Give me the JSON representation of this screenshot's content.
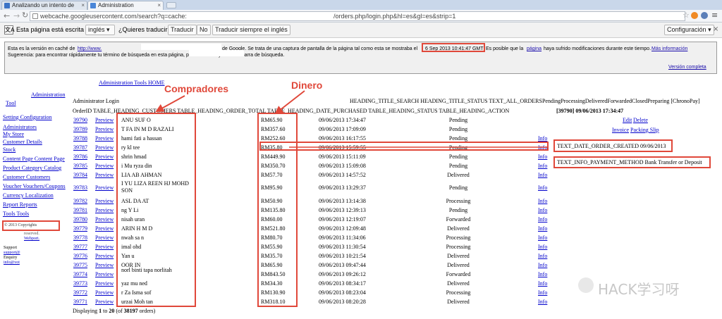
{
  "tabs": [
    {
      "label": "Analizando un intento de"
    },
    {
      "label": "Administration"
    }
  ],
  "address": {
    "left": "webcache.googleusercontent.com/search?q=cache:",
    "right": "/orders.php/login.php&hl=es&gl=es&strip=1"
  },
  "translate": {
    "prefix": "Esta página está escrita en",
    "language": "inglés",
    "question": "¿Quieres traducirla?",
    "translate_btn": "Traducir",
    "no_btn": "No",
    "always_btn": "Traducir siempre el inglés",
    "config_btn": "Configuración"
  },
  "cache": {
    "line1_a": "Esta es la versión en caché de",
    "line1_link": "http://www.",
    "line1_b": "de Google. Se trata de una captura de pantalla de la página tal como esta se mostraba el",
    "timestamp": "6 Sep 2013 10:41:47 GMT",
    "line1_c": "Es posible que la",
    "page_link": "página",
    "line1_d": "haya sufrido modificaciones durante este tiempo.",
    "more_info": "Más información",
    "line2_a": "Sugerencia: para encontrar rápidamente tu término de búsqueda en esta página, pulsa",
    "line2_b": "y utiliza la barra de búsqueda.",
    "full_version": "Versión completa"
  },
  "annotations": {
    "buyers": "Compradores",
    "money": "Dinero",
    "watermark": "HACK学习呀"
  },
  "header": {
    "admin_tools_home": "Administration Tools  HOME",
    "admin_login": "Administrator Login",
    "col_labels": "OrderID TABLE_HEADING_CUSTOMERS TABLE_HEADING_ORDER_TOTAL TABLE_HEADING_DATE_PURCHASED TABLE_HEADING_STATUS TABLE_HEADING_ACTION",
    "title_search": "HEADING_TITLE_SEARCH HEADING_TITLE_STATUS TEXT_ALL_ORDERSPendingProcessingDeliveredForwardedClosedPreparing [ChronoPay]"
  },
  "sidebar": {
    "administration": "Administration",
    "tool": "Tool",
    "items": [
      "Setting  Configuration",
      "Administrators",
      "My Store",
      "Customer Details",
      "Stock",
      "Content Page  Content Page",
      "Product Category  Catalog",
      "Customer  Customers",
      "Voucher  Vouchers/Coupons",
      "Currency  Localization",
      "Report  Reports",
      "Tools  Tools"
    ],
    "copyright": "© 2013 Copyrights",
    "reserved": "reserved.",
    "webport": "Webport.",
    "support": "Support",
    "support_mail": "support@",
    "enquiry": "Enquiry",
    "info_mail": "info@vot"
  },
  "orders": [
    {
      "id": "39790",
      "preview": "Preview",
      "customer": "ANU    SUF    O",
      "total": "RM65.90",
      "date": "09/06/2013 17:34:47",
      "status": "Pending",
      "action": ""
    },
    {
      "id": "39789",
      "preview": "Preview",
      "customer": "T FA     IN M     D RAZALI",
      "total": "RM357.60",
      "date": "09/06/2013 17:09:09",
      "status": "Pending",
      "action": ""
    },
    {
      "id": "39788",
      "preview": "Preview",
      "customer": "hami     fati     a hassan",
      "total": "RM252.60",
      "date": "09/06/2013 16:17:55",
      "status": "Pending",
      "action": "Info"
    },
    {
      "id": "39787",
      "preview": "Preview",
      "customer": "ry kl     tee",
      "total": "RM35.80",
      "date": "09/06/2013 15:59:55",
      "status": "Pending",
      "action": "Info"
    },
    {
      "id": "39786",
      "preview": "Preview",
      "customer": "shrin     hmad",
      "total": "RM449.90",
      "date": "09/06/2013 15:11:09",
      "status": "Pending",
      "action": "Info"
    },
    {
      "id": "39785",
      "preview": "Preview",
      "customer": "i Mu     ryza     din",
      "total": "RM350.70",
      "date": "09/06/2013 15:09:08",
      "status": "Pending",
      "action": "Info"
    },
    {
      "id": "39784",
      "preview": "Preview",
      "customer": "LIA     AB     AHMAN",
      "total": "RM57.70",
      "date": "09/06/2013 14:57:52",
      "status": "Delivered",
      "action": "Info"
    },
    {
      "id": "39783",
      "preview": "Preview",
      "customer": "I YU     LIZA     REEN HJ MOHD     SON",
      "total": "RM95.90",
      "date": "09/06/2013 13:29:37",
      "status": "Pending",
      "action": "Info"
    },
    {
      "id": "39782",
      "preview": "Preview",
      "customer": "ASL     DA     AT",
      "total": "RM50.90",
      "date": "09/06/2013 13:14:38",
      "status": "Processing",
      "action": "Info"
    },
    {
      "id": "39781",
      "preview": "Preview",
      "customer": "ng Y     Li",
      "total": "RM135.80",
      "date": "09/06/2013 12:39:13",
      "status": "Pending",
      "action": "Info"
    },
    {
      "id": "39780",
      "preview": "Preview",
      "customer": "nisah     uran",
      "total": "RM60.00",
      "date": "09/06/2013 12:19:07",
      "status": "Forwarded",
      "action": "Info"
    },
    {
      "id": "39779",
      "preview": "Preview",
      "customer": "ARIN     H M     D",
      "total": "RM521.80",
      "date": "09/06/2013 12:09:48",
      "status": "Delivered",
      "action": "Info"
    },
    {
      "id": "39778",
      "preview": "Preview",
      "customer": "nwah     sa     n",
      "total": "RM80.70",
      "date": "09/06/2013 11:34:06",
      "status": "Processing",
      "action": "Info"
    },
    {
      "id": "39777",
      "preview": "Preview",
      "customer": "imal     ohd",
      "total": "RM55.90",
      "date": "09/06/2013 11:30:54",
      "status": "Processing",
      "action": "Info"
    },
    {
      "id": "39776",
      "preview": "Preview",
      "customer": "Yan     u",
      "total": "RM35.70",
      "date": "09/06/2013 10:21:54",
      "status": "Delivered",
      "action": "Info"
    },
    {
      "id": "39775",
      "preview": "Preview",
      "customer": "OOR     IN",
      "total": "RM65.90",
      "date": "09/06/2013 09:47:44",
      "status": "Delivered",
      "action": "Info"
    },
    {
      "id": "39774",
      "preview": "Preview",
      "customer": "norl     binti     tapa norlitah",
      "total": "RM843.50",
      "date": "09/06/2013 09:26:12",
      "status": "Forwarded",
      "action": "Info"
    },
    {
      "id": "39773",
      "preview": "Preview",
      "customer": "yaz     mu     ned",
      "total": "RM34.30",
      "date": "09/06/2013 08:34:17",
      "status": "Delivered",
      "action": "Info"
    },
    {
      "id": "39772",
      "preview": "Preview",
      "customer": "r Za     Isma     sof",
      "total": "RM130.90",
      "date": "09/06/2013 08:23:04",
      "status": "Processing",
      "action": "Info"
    },
    {
      "id": "39771",
      "preview": "Preview",
      "customer": "urzai     Moh     tan",
      "total": "RM318.10",
      "date": "09/06/2013 08:20:28",
      "status": "Delivered",
      "action": "Info"
    }
  ],
  "footer": {
    "a": "Displaying",
    "from": "1",
    "b": "to",
    "to": "20",
    "c": "(of",
    "total": "38197",
    "d": "orders)"
  },
  "detail": {
    "id_date": "[39790]  09/06/2013 17:34:47",
    "edit": "Edit",
    "delete": "Delete",
    "invoice": "Invoice",
    "packing": "Packing Slip",
    "date_created": "TEXT_DATE_ORDER_CREATED 09/06/2013",
    "payment": "TEXT_INFO_PAYMENT_METHOD Bank Transfer or Deposit"
  },
  "colors": {
    "annotation": "#e0483a",
    "link": "#0000cc"
  }
}
